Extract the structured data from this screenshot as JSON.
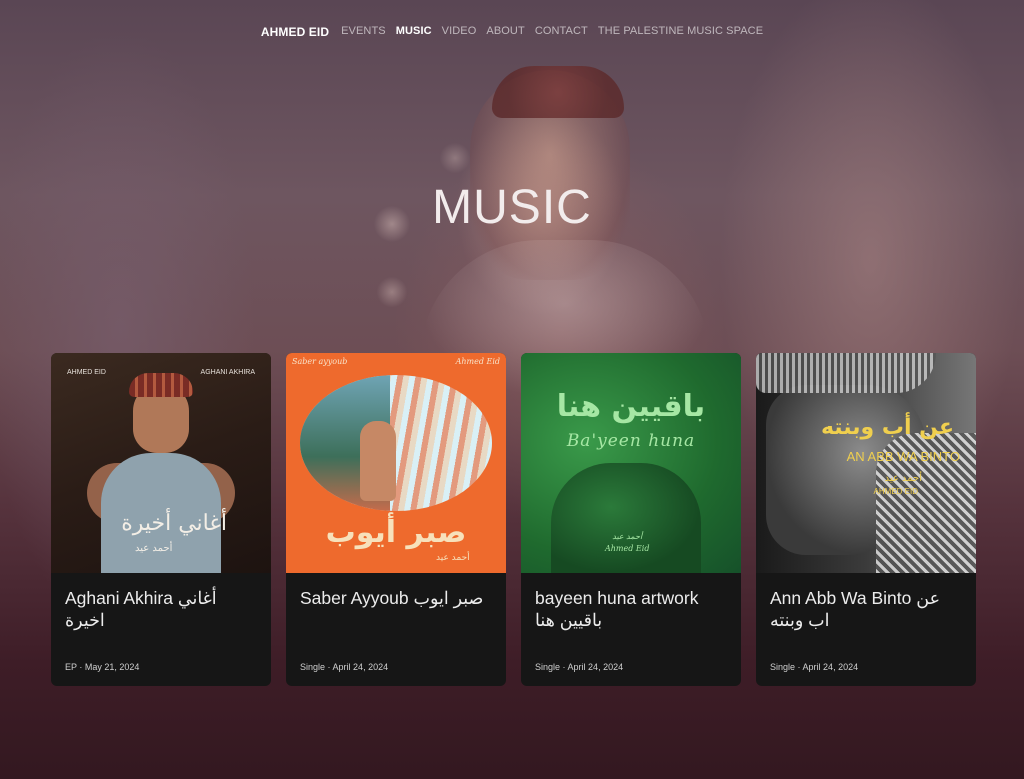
{
  "nav": {
    "brand": "AHMED EID",
    "items": [
      {
        "label": "EVENTS"
      },
      {
        "label": "MUSIC"
      },
      {
        "label": "VIDEO"
      },
      {
        "label": "ABOUT"
      },
      {
        "label": "CONTACT"
      },
      {
        "label": "THE PALESTINE MUSIC SPACE"
      }
    ],
    "active": "MUSIC"
  },
  "hero": {
    "title": "MUSIC"
  },
  "cards": [
    {
      "title": "Aghani Akhira أغاني اخيرة",
      "type": "EP",
      "date": "May 21, 2024",
      "art": {
        "top_left": "AHMED EID",
        "top_right": "AGHANI AKHIRA",
        "arabic": "أغاني أخيرة",
        "arabic_sub": "أحمد عيد"
      }
    },
    {
      "title": "Saber Ayyoub صبر ايوب",
      "type": "Single",
      "date": "April 24, 2024",
      "art": {
        "top_left": "Saber ayyoub",
        "top_right": "Ahmed Eid",
        "arabic": "صبر أيوب",
        "arabic_sub": "أحمد عيد"
      }
    },
    {
      "title": "bayeen huna artwork باقيين هنا",
      "type": "Single",
      "date": "April 24, 2024",
      "art": {
        "arabic": "باقيين هنا",
        "latin": "Ba'yeen huna",
        "arabic_sub": "أحمد عيد",
        "latin_sub": "Ahmed Eid"
      }
    },
    {
      "title": "Ann Abb Wa Binto عن اب وبنته",
      "type": "Single",
      "date": "April 24, 2024",
      "art": {
        "arabic": "عن أب وبنته",
        "latin": "AN ABB WA BINTO",
        "arabic_sub": "أحمد عيد",
        "latin_sub": "AHMED EID"
      }
    }
  ]
}
